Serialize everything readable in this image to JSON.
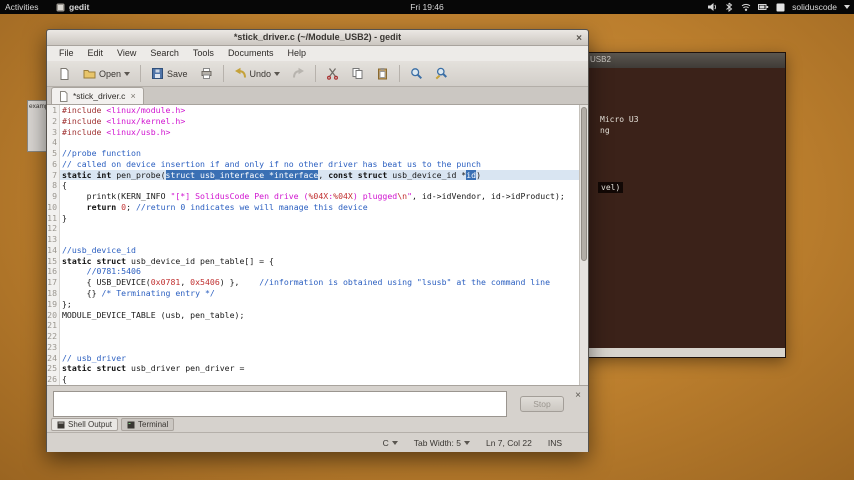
{
  "colors": {
    "desktop": "#bb7e2d",
    "selection": "#3a70b4",
    "string": "#d014d0",
    "comment": "#2b5fc0",
    "current_line": "#d9e5f2",
    "topbar": "#070707"
  },
  "icons": {
    "close": "×",
    "chevron": "▾"
  },
  "topbar": {
    "activities": "Activities",
    "app_name": "gedit",
    "clock": "Fri 19:46",
    "username": "soliduscode",
    "status_icons": [
      "volume",
      "bluetooth",
      "network",
      "battery",
      "input-source"
    ]
  },
  "background_window": {
    "fragment": "exampl"
  },
  "terminal": {
    "title": "USB2",
    "lines": [
      "Micro U3",
      "ng",
      "vel)"
    ]
  },
  "gedit": {
    "title": "*stick_driver.c (~/Module_USB2) - gedit",
    "menus": [
      "File",
      "Edit",
      "View",
      "Search",
      "Tools",
      "Documents",
      "Help"
    ],
    "toolbar": {
      "open": "Open",
      "save": "Save",
      "undo": "Undo"
    },
    "tab": "*stick_driver.c",
    "code": {
      "lines": [
        {
          "n": 1,
          "s": [
            [
              "p",
              "#include "
            ],
            [
              "s",
              "<linux/module.h>"
            ]
          ]
        },
        {
          "n": 2,
          "s": [
            [
              "p",
              "#include "
            ],
            [
              "s",
              "<linux/kernel.h>"
            ]
          ]
        },
        {
          "n": 3,
          "s": [
            [
              "p",
              "#include "
            ],
            [
              "s",
              "<linux/usb.h>"
            ]
          ]
        },
        {
          "n": 4,
          "s": []
        },
        {
          "n": 5,
          "s": [
            [
              "c",
              "//probe function"
            ]
          ]
        },
        {
          "n": 6,
          "s": [
            [
              "c",
              "// called on device insertion if and only if no other driver has beat us to the punch"
            ]
          ]
        },
        {
          "n": 7,
          "cur": true,
          "s": [
            [
              "k",
              "static int"
            ],
            [
              "t",
              " pen_probe("
            ],
            [
              "sel",
              "struct usb_interface *interface"
            ],
            [
              "t",
              ", "
            ],
            [
              "k",
              "const struct"
            ],
            [
              "t",
              " usb_device_id *"
            ],
            [
              "sel2",
              "id"
            ],
            [
              "t",
              ")"
            ]
          ]
        },
        {
          "n": 8,
          "s": [
            [
              "t",
              "{"
            ]
          ]
        },
        {
          "n": 9,
          "s": [
            [
              "t",
              "     printk(KERN_INFO "
            ],
            [
              "s",
              "\"[*] SolidusCode Pen drive ("
            ],
            [
              "f",
              "%04X"
            ],
            [
              "s",
              ":"
            ],
            [
              "f",
              "%04X"
            ],
            [
              "s",
              ") plugged"
            ],
            [
              "f",
              "\\n"
            ],
            [
              "s",
              "\""
            ],
            [
              "t",
              ", id->idVendor, id->idProduct);"
            ]
          ]
        },
        {
          "n": 10,
          "s": [
            [
              "t",
              "     "
            ],
            [
              "k",
              "return"
            ],
            [
              "t",
              " "
            ],
            [
              "n",
              "0"
            ],
            [
              "t",
              "; "
            ],
            [
              "c",
              "//return 0 indicates we will manage this device"
            ]
          ]
        },
        {
          "n": 11,
          "s": [
            [
              "t",
              "}"
            ]
          ]
        },
        {
          "n": 12,
          "s": []
        },
        {
          "n": 13,
          "s": []
        },
        {
          "n": 14,
          "s": [
            [
              "c",
              "//usb_device_id"
            ]
          ]
        },
        {
          "n": 15,
          "s": [
            [
              "k",
              "static struct"
            ],
            [
              "t",
              " usb_device_id pen_table[] = {"
            ]
          ]
        },
        {
          "n": 16,
          "s": [
            [
              "t",
              "     "
            ],
            [
              "c",
              "//0781:5406"
            ]
          ]
        },
        {
          "n": 17,
          "s": [
            [
              "t",
              "     { USB_DEVICE("
            ],
            [
              "n",
              "0x0781"
            ],
            [
              "t",
              ", "
            ],
            [
              "n",
              "0x5406"
            ],
            [
              "t",
              ") },    "
            ],
            [
              "c",
              "//information is obtained using \"lsusb\" at the command line"
            ]
          ]
        },
        {
          "n": 18,
          "s": [
            [
              "t",
              "     {} "
            ],
            [
              "c",
              "/* Terminating entry */"
            ]
          ]
        },
        {
          "n": 19,
          "s": [
            [
              "t",
              "};"
            ]
          ]
        },
        {
          "n": 20,
          "s": [
            [
              "t",
              "MODULE_DEVICE_TABLE (usb, pen_table);"
            ]
          ]
        },
        {
          "n": 21,
          "s": []
        },
        {
          "n": 22,
          "s": []
        },
        {
          "n": 23,
          "s": []
        },
        {
          "n": 24,
          "s": [
            [
              "c",
              "// usb_driver"
            ]
          ]
        },
        {
          "n": 25,
          "s": [
            [
              "k",
              "static struct"
            ],
            [
              "t",
              " usb_driver pen_driver ="
            ]
          ]
        },
        {
          "n": 26,
          "s": [
            [
              "t",
              "{"
            ]
          ]
        }
      ]
    },
    "bottom_panel": {
      "tabs": [
        "Shell Output",
        "Terminal"
      ],
      "stop": "Stop"
    },
    "statusbar": {
      "lang": "C",
      "tab_width": "Tab Width: 5",
      "position": "Ln 7, Col 22",
      "mode": "INS"
    }
  }
}
